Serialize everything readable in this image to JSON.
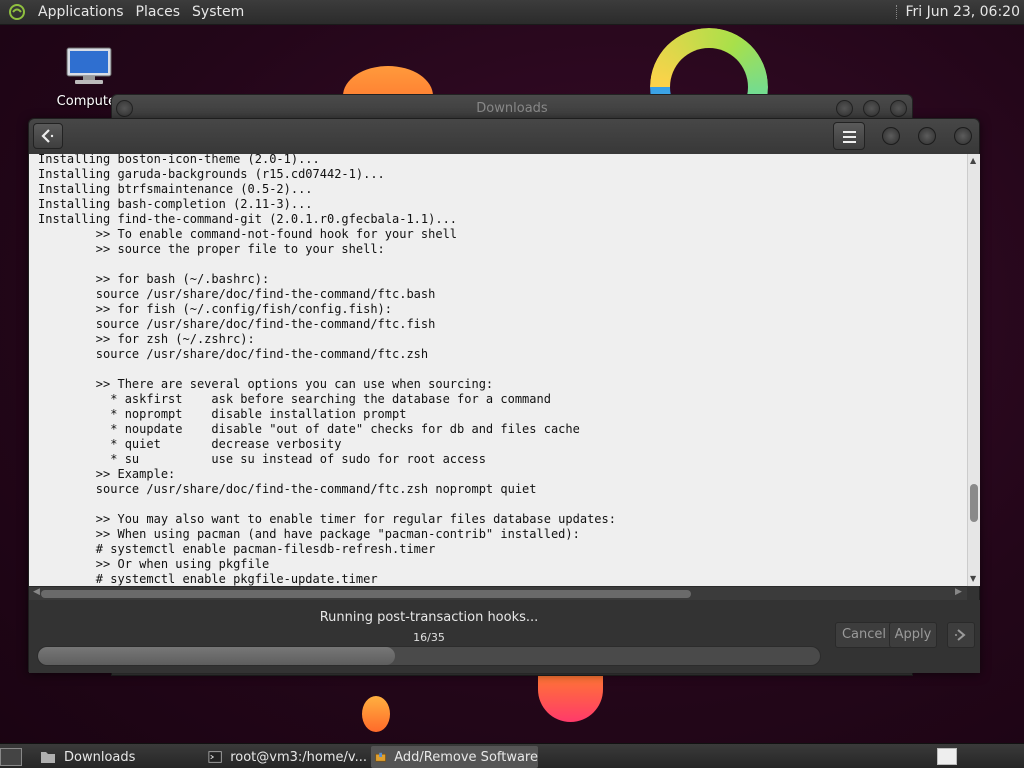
{
  "top_panel": {
    "menus": [
      "Applications",
      "Places",
      "System"
    ],
    "clock": "Fri Jun 23, 06:20"
  },
  "desktop": {
    "icons": [
      {
        "label": "Computer",
        "icon": "computer-icon"
      }
    ]
  },
  "background_window": {
    "title": "Downloads"
  },
  "main_window": {
    "terminal_lines": [
      "Installing boston-icon-theme (2.0-1)...",
      "Installing garuda-backgrounds (r15.cd07442-1)...",
      "Installing btrfsmaintenance (0.5-2)...",
      "Installing bash-completion (2.11-3)...",
      "Installing find-the-command-git (2.0.1.r0.gfecbala-1.1)...",
      "        >> To enable command-not-found hook for your shell",
      "        >> source the proper file to your shell:",
      "",
      "        >> for bash (~/.bashrc):",
      "        source /usr/share/doc/find-the-command/ftc.bash",
      "        >> for fish (~/.config/fish/config.fish):",
      "        source /usr/share/doc/find-the-command/ftc.fish",
      "        >> for zsh (~/.zshrc):",
      "        source /usr/share/doc/find-the-command/ftc.zsh",
      "",
      "        >> There are several options you can use when sourcing:",
      "          * askfirst    ask before searching the database for a command",
      "          * noprompt    disable installation prompt",
      "          * noupdate    disable \"out of date\" checks for db and files cache",
      "          * quiet       decrease verbosity",
      "          * su          use su instead of sudo for root access",
      "        >> Example:",
      "        source /usr/share/doc/find-the-command/ftc.zsh noprompt quiet",
      "",
      "        >> You may also want to enable timer for regular files database updates:",
      "        >> When using pacman (and have package \"pacman-contrib\" installed):",
      "        # systemctl enable pacman-filesdb-refresh.timer",
      "        >> Or when using pkgfile",
      "        # systemctl enable pkgfile-update.timer"
    ],
    "status_text": "Running post-transaction hooks...",
    "progress_count": "16/35",
    "progress_fraction": 0.457,
    "cancel_label": "Cancel",
    "apply_label": "Apply",
    "next_icon": "chevron-right-icon"
  },
  "taskbar": {
    "tasks": [
      {
        "label": "Downloads",
        "icon": "folder-icon"
      },
      {
        "label": "root@vm3:/home/v...",
        "icon": "terminal-icon"
      },
      {
        "label": "Add/Remove Software",
        "icon": "package-icon",
        "active": true
      }
    ]
  }
}
